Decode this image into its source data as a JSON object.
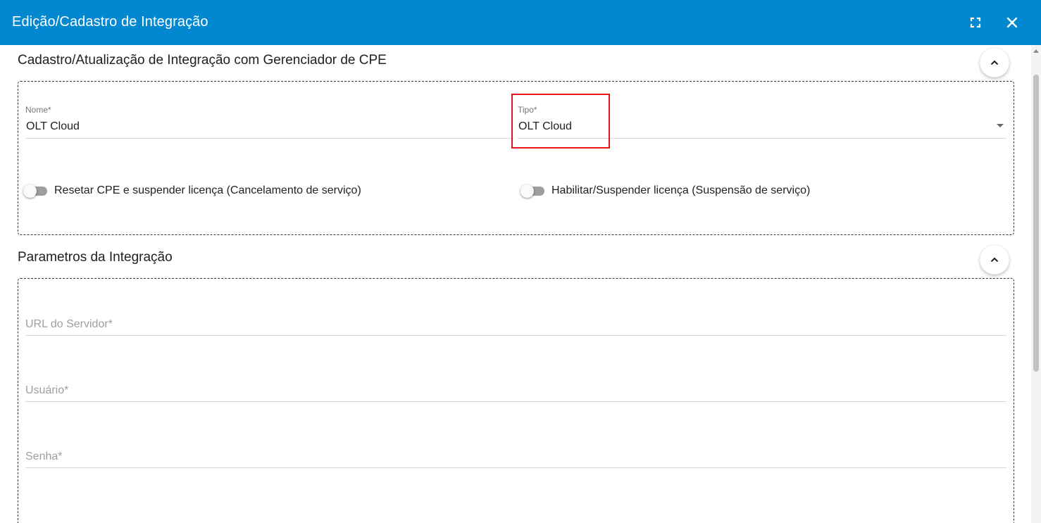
{
  "dialog": {
    "title": "Edição/Cadastro de Integração"
  },
  "section_cadastro": {
    "title": "Cadastro/Atualização de Integração com Gerenciador de CPE",
    "nome": {
      "label": "Nome",
      "required": "*",
      "value": "OLT Cloud"
    },
    "tipo": {
      "label": "Tipo",
      "required": "*",
      "value": "OLT Cloud"
    },
    "toggle_reset": {
      "label": "Resetar CPE e suspender licença (Cancelamento de serviço)",
      "state": "off"
    },
    "toggle_habilitar": {
      "label": "Habilitar/Suspender licença (Suspensão de serviço)",
      "state": "off"
    }
  },
  "section_parametros": {
    "title": "Parametros da Integração",
    "url": {
      "placeholder": "URL do Servidor",
      "required": "*"
    },
    "usuario": {
      "placeholder": "Usuário",
      "required": "*"
    },
    "senha": {
      "placeholder": "Senha",
      "required": "*"
    }
  },
  "colors": {
    "header": "#0288d1",
    "highlight": "#e0161c"
  },
  "icons": {
    "fullscreen": "fullscreen-icon",
    "close": "close-icon",
    "collapse": "chevron-up-icon",
    "dropdown": "caret-down-icon"
  }
}
